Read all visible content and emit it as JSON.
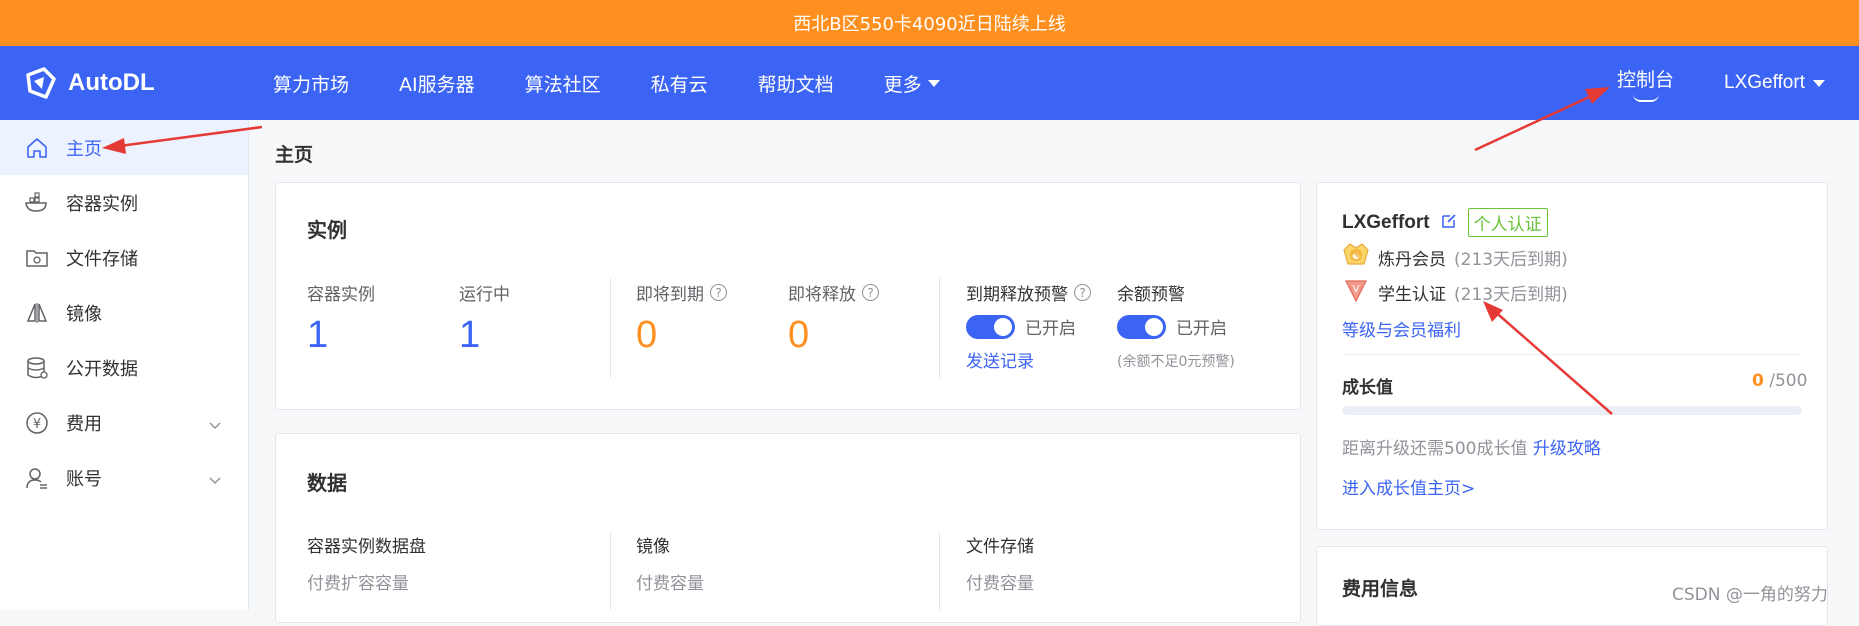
{
  "banner": {
    "text": "西北B区550卡4090近日陆续上线"
  },
  "topnav": {
    "logo_text": "AutoDL",
    "items": [
      "算力市场",
      "AI服务器",
      "算法社区",
      "私有云",
      "帮助文档",
      "更多"
    ],
    "console_label": "控制台",
    "username": "LXGeffort"
  },
  "sidebar": {
    "items": [
      {
        "label": "主页",
        "icon": "home-icon",
        "active": true
      },
      {
        "label": "容器实例",
        "icon": "container-icon"
      },
      {
        "label": "文件存储",
        "icon": "storage-icon"
      },
      {
        "label": "镜像",
        "icon": "mirror-icon"
      },
      {
        "label": "公开数据",
        "icon": "database-icon"
      },
      {
        "label": "费用",
        "icon": "yen-icon",
        "expandable": true
      },
      {
        "label": "账号",
        "icon": "user-icon",
        "expandable": true
      }
    ]
  },
  "main": {
    "page_title": "主页",
    "instance_card": {
      "title": "实例",
      "container_label": "容器实例",
      "container_value": "1",
      "running_label": "运行中",
      "running_value": "1",
      "expiring_label": "即将到期",
      "expiring_value": "0",
      "releasing_label": "即将释放",
      "releasing_value": "0",
      "expire_warn_label": "到期释放预警",
      "expire_warn_state": "已开启",
      "send_record_link": "发送记录",
      "balance_warn_label": "余额预警",
      "balance_warn_state": "已开启",
      "balance_warn_note": "(余额不足0元预警)"
    },
    "data_card": {
      "title": "数据",
      "col1_label": "容器实例数据盘",
      "col1_sub": "付费扩容容量",
      "col2_label": "镜像",
      "col2_sub": "付费容量",
      "col3_label": "文件存储",
      "col3_sub": "付费容量"
    }
  },
  "profile": {
    "username": "LXGeffort",
    "verify_badge": "个人认证",
    "member_label": "炼丹会员",
    "member_expire": "(213天后到期)",
    "student_label": "学生认证",
    "student_expire": "(213天后到期)",
    "benefits_link": "等级与会员福利",
    "growth_label": "成长值",
    "growth_current": "0",
    "growth_total": "/500",
    "growth_fraction": 0,
    "upgrade_text": "距离升级还需500成长值",
    "upgrade_link": "升级攻略",
    "growth_home_link": "进入成长值主页>"
  },
  "fee_card": {
    "title": "费用信息"
  },
  "watermark": "CSDN @一角的努力",
  "colors": {
    "brand": "#3c64f4",
    "banner": "#ff8f1f",
    "success": "#67c23a",
    "arrow": "#e53935"
  }
}
